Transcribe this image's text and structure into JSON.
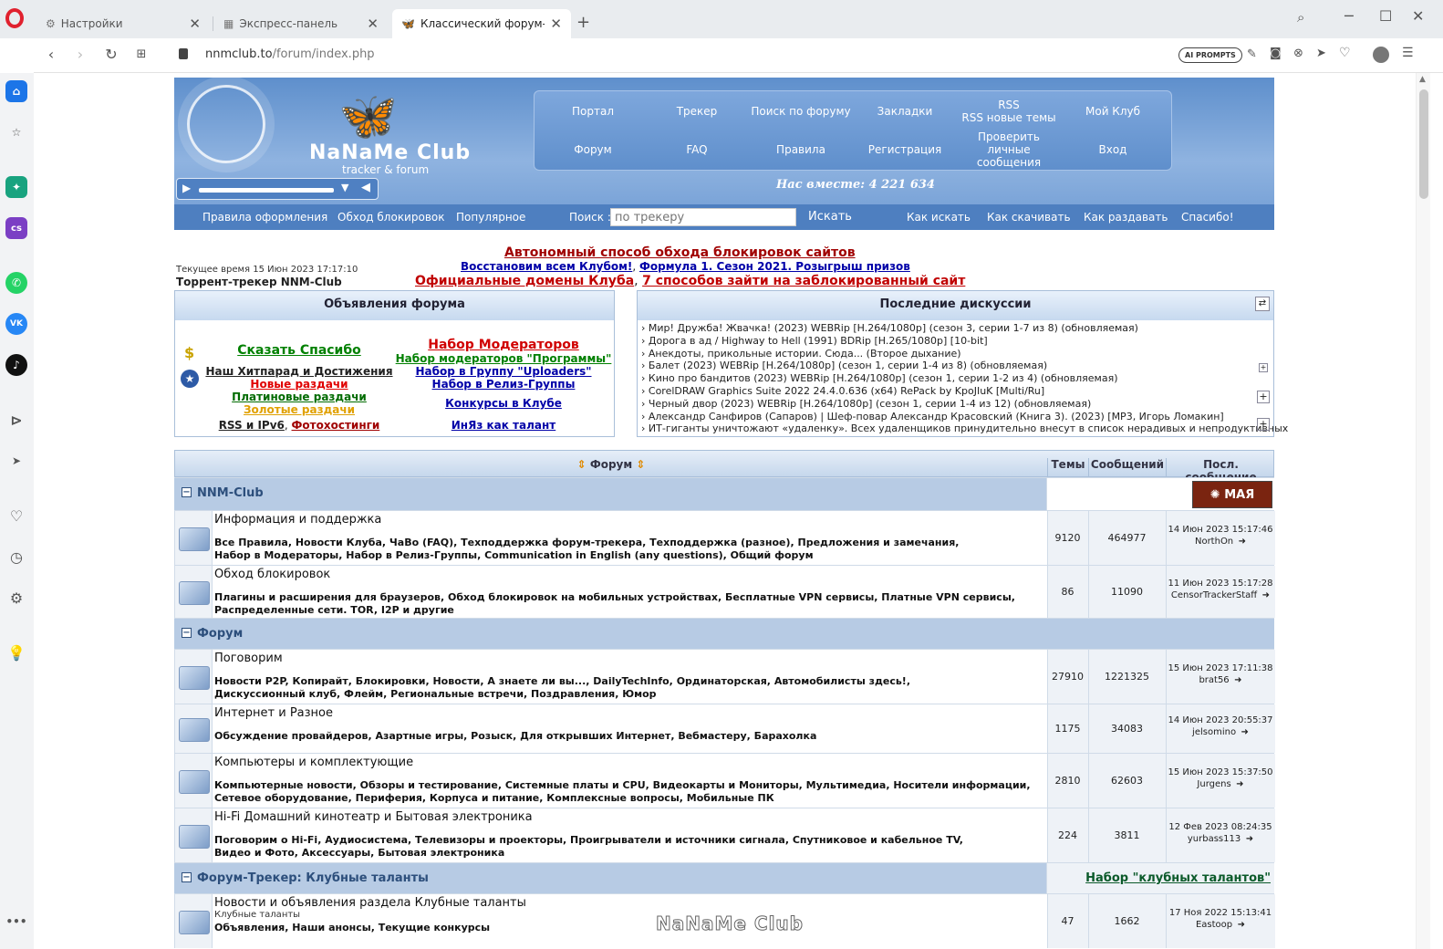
{
  "browser": {
    "tabs": [
      {
        "label": "Настройки",
        "icon": "gear-icon"
      },
      {
        "label": "Экспресс-панель",
        "icon": "grid-icon"
      },
      {
        "label": "Классический форум-тре",
        "icon": "butterfly-icon"
      }
    ],
    "new_tab": "+",
    "url_domain": "nnmclub.to",
    "url_path": "/forum/index.php",
    "ai_prompts": "AI PROMPTS"
  },
  "header": {
    "logo_title": "NaNaMe Club",
    "logo_sub": "tracker & forum",
    "nav_top": [
      "Портал",
      "Трекер",
      "Поиск по форуму",
      "Закладки",
      "RSS\nRSS новые темы",
      "Мой Клуб"
    ],
    "nav_bottom": [
      "Форум",
      "FAQ",
      "Правила",
      "Регистрация",
      "Проверить личные сообщения",
      "Вход"
    ],
    "together": "Нас вместе: 4 221 634",
    "subnav": [
      "Правила оформления",
      "Обход блокировок",
      "Популярное"
    ],
    "search_label": "Поиск :",
    "search_placeholder": "по трекеру",
    "search_button": "Искать",
    "subnav_right": [
      "Как искать",
      "Как скачивать",
      "Как раздавать",
      "Спасибо!"
    ]
  },
  "info": {
    "time": "Текущее время 15 Июн 2023 17:17:10",
    "tracker_name": "Торрент-трекер NNM-Club",
    "banner1": "Автономный способ обхода блокировок сайтов",
    "banner2a": "Восстановим всем Клубом!",
    "banner2b": "Формула 1. Сезон 2021. Розыгрыш призов",
    "banner3a": "Официальные домены Клуба",
    "banner3b": "7 способов зайти на заблокированный сайт"
  },
  "announcements": {
    "title": "Объявления форума",
    "left": [
      "Сказать Спасибо",
      "Наш Хитпарад и Достижения",
      "Новые раздачи",
      "Платиновые раздачи",
      "Золотые раздачи",
      "RSS и IPv6",
      "Фотохостинги"
    ],
    "right": [
      "Набор Модераторов",
      "Набор модераторов \"Программы\"",
      "Набор в Группу \"Uploaders\"",
      "Набор в Релиз-Группы",
      "Конкурсы в Клубе",
      "ИнЯз как талант"
    ]
  },
  "discussions": {
    "title": "Последние дискуссии",
    "items": [
      "› Мир! Дружба! Жвачка! (2023) WEBRip [H.264/1080p] (сезон 3, серии 1-7 из 8) (обновляемая)",
      "› Дорога в ад / Highway to Hell (1991) BDRip [H.265/1080p] [10-bit]",
      "› Анекдоты, прикольные истории. Сюда... (Второе дыхание)",
      "› Балет (2023) WEBRip [H.264/1080p] (сезон 1, серии 1-4 из 8) (обновляемая)",
      "› Кино про бандитов (2023) WEBRip [H.264/1080p] (сезон 1, серии 1-2 из 4) (обновляемая)",
      "› CorelDRAW Graphics Suite 2022 24.4.0.636 (x64) RePack by KpoJIuK [Multi/Ru]",
      "› Черный двор (2023) WEBRip [H.264/1080p] (сезон 1, серии 1-4 из 12) (обновляемая)",
      "› Александр Санфиров (Сапаров) | Шеф-повар Александр Красовский (Книга 3). (2023) [MP3, Игорь Ломакин]",
      "› ИТ-гиганты уничтожают «удаленку». Всех удаленщиков принудительно внесут в список нерадивых и непродуктивных"
    ]
  },
  "forum_table": {
    "col_forum": "Форум",
    "col_topics": "Темы",
    "col_posts": "Сообщений",
    "col_last": "Посл. сообщение",
    "categories": [
      {
        "name": "NNM-Club",
        "extra": ""
      },
      {
        "name": "Форум",
        "extra": ""
      },
      {
        "name": "Форум-Трекер: Клубные таланты",
        "extra": "Набор \"клубных талантов\""
      }
    ],
    "forums": [
      {
        "title": "Информация и поддержка",
        "desc": "",
        "sub1": "Все Правила,  Новости Клуба,  ЧаВо (FAQ),  Техподдержка форум-трекера,  Техподдержка (разное),  Предложения и замечания,",
        "sub2": "Набор в Модераторы,  Набор в Релиз-Группы,  Communication in English (any questions),  Общий форум",
        "topics": "9120",
        "posts": "464977",
        "date": "14 Июн 2023 15:17:46",
        "user": "NorthOn"
      },
      {
        "title": "Обход блокировок",
        "desc": "",
        "sub1": "Плагины и расширения для браузеров,  Обход блокировок на мобильных устройствах,  Бесплатные VPN сервисы,  Платные VPN сервисы,",
        "sub2": "Распределенные сети. TOR, I2P и другие",
        "topics": "86",
        "posts": "11090",
        "date": "11 Июн 2023 15:17:28",
        "user": "CensorTrackerStaff"
      },
      {
        "title": "Поговорим",
        "desc": "",
        "sub1": "Новости P2P, Копирайт, Блокировки,  Новости,  А знаете ли вы...,  DailyTechInfo,  Ординаторская,  Автомобилисты здесь!,",
        "sub2": "Дискуссионный клуб,  Флейм,  Региональные встречи,  Поздравления,  Юмор",
        "topics": "27910",
        "posts": "1221325",
        "date": "15 Июн 2023 17:11:38",
        "user": "brat56"
      },
      {
        "title": "Интернет и Разное",
        "desc": "",
        "sub1": "Обсуждение провайдеров,  Азартные игры,  Розыск,  Для открывших Интернет,  Вебмастеру,  Барахолка",
        "sub2": "",
        "topics": "1175",
        "posts": "34083",
        "date": "14 Июн 2023 20:55:37",
        "user": "jelsomino"
      },
      {
        "title": "Компьютеры и комплектующие",
        "desc": "",
        "sub1": "Компьютерные новости,  Обзоры и тестирование,  Системные платы и CPU,  Видеокарты и Мониторы,  Мультимедиа,  Носители информации,",
        "sub2": "Сетевое оборудование,  Периферия,  Корпуса и питание,  Комплексные вопросы,  Мобильные ПК",
        "topics": "2810",
        "posts": "62603",
        "date": "15 Июн 2023 15:37:50",
        "user": "Jurgens"
      },
      {
        "title": "Hi-Fi Домашний кинотеатр и Бытовая электроника",
        "desc": "",
        "sub1": "Поговорим о Hi-Fi,  Аудиосистема,  Телевизоры и проекторы,  Проигрыватели и источники сигнала,  Спутниковое и кабельное TV,",
        "sub2": "Видео и Фото,  Аксессуары,  Бытовая электроника",
        "topics": "224",
        "posts": "3811",
        "date": "12 Фев 2023 08:24:35",
        "user": "yurbass113"
      },
      {
        "title": "Новости и объявления раздела Клубные таланты",
        "desc": "Клубные таланты",
        "sub1": "Объявления,  Наши анонсы,  Текущие конкурсы",
        "sub2": "",
        "topics": "47",
        "posts": "1662",
        "date": "17 Ноя 2022 15:13:41",
        "user": "Eastoop"
      }
    ],
    "watermark": "NaNaMe Club"
  }
}
